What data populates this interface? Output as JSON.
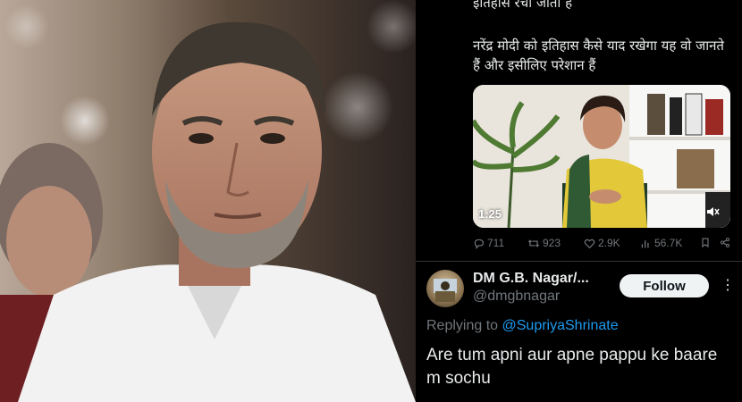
{
  "tweet": {
    "text_line_top": "इतिहास रचा जाता है",
    "text_paragraph": "नरेंद्र मोदी को इतिहास कैसे याद रखेगा यह वो जानते हैं और इसीलिए परेशान हैं",
    "video_duration": "1:25",
    "stats": {
      "replies": "711",
      "retweets": "923",
      "likes": "2.9K",
      "views": "56.7K"
    }
  },
  "reply": {
    "name": "DM G.B. Nagar/...",
    "handle": "@dmgbnagar",
    "follow_label": "Follow",
    "replying_prefix": "Replying to ",
    "replying_mention": "@SupriyaShrinate",
    "text": "Are tum apni aur apne pappu ke baare m sochu"
  },
  "icons": {
    "reply": "reply-icon",
    "retweet": "retweet-icon",
    "like": "heart-icon",
    "views": "views-icon",
    "bookmark": "bookmark-icon",
    "share": "share-icon",
    "mute": "mute-icon",
    "more": "more-icon"
  },
  "colors": {
    "background": "#000000",
    "text": "#e7e9ea",
    "muted": "#71767b",
    "link": "#1d9bf0",
    "follow_bg": "#eff3f4"
  }
}
